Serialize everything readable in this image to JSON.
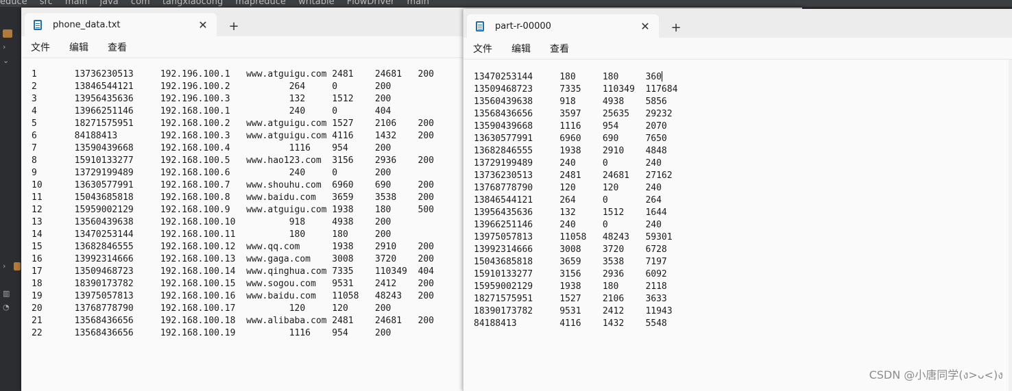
{
  "ide": {
    "breadcrumbs": [
      "educe",
      "src",
      "main",
      "java",
      "com",
      "tangxiaocong",
      "mapreduce",
      "writable",
      "FlowDriver",
      "main"
    ]
  },
  "left_window": {
    "tab_title": "phone_data.txt",
    "close_symbol": "✕",
    "new_tab_symbol": "+",
    "menu": {
      "file": "文件",
      "edit": "编辑",
      "view": "查看"
    },
    "content": "1\t13736230513\t192.196.100.1\twww.atguigu.com\t2481\t24681\t200\n2\t13846544121\t192.196.100.2\t\t264\t0\t200\n3 \t13956435636\t192.196.100.3\t\t132\t1512\t200\n4 \t13966251146\t192.168.100.1\t\t240\t0\t404\n5 \t18271575951\t192.168.100.2\twww.atguigu.com\t1527\t2106\t200\n6 \t84188413\t192.168.100.3\twww.atguigu.com\t4116\t1432\t200\n7 \t13590439668\t192.168.100.4\t\t1116\t954\t200\n8 \t15910133277\t192.168.100.5\twww.hao123.com\t3156\t2936\t200\n9 \t13729199489\t192.168.100.6\t\t240\t0\t200\n10 \t13630577991\t192.168.100.7\twww.shouhu.com\t6960\t690\t200\n11 \t15043685818\t192.168.100.8\twww.baidu.com\t3659\t3538\t200\n12 \t15959002129\t192.168.100.9\twww.atguigu.com\t1938\t180\t500\n13 \t13560439638\t192.168.100.10\t\t918\t4938\t200\n14 \t13470253144\t192.168.100.11\t\t180\t180\t200\n15 \t13682846555\t192.168.100.12\twww.qq.com\t1938\t2910\t200\n16 \t13992314666\t192.168.100.13\twww.gaga.com\t3008\t3720\t200\n17 \t13509468723\t192.168.100.14\twww.qinghua.com\t7335\t110349\t404\n18 \t18390173782\t192.168.100.15\twww.sogou.com\t9531\t2412\t200\n19 \t13975057813\t192.168.100.16\twww.baidu.com\t11058\t48243\t200\n20 \t13768778790\t192.168.100.17\t\t120\t120\t200\n21 \t13568436656\t192.168.100.18\twww.alibaba.com\t2481\t24681\t200\n22 \t13568436656\t192.168.100.19\t\t1116\t954\t200"
  },
  "right_window": {
    "tab_title": "part-r-00000",
    "close_symbol": "✕",
    "new_tab_symbol": "+",
    "menu": {
      "file": "文件",
      "edit": "编辑",
      "view": "查看"
    },
    "content": "13470253144\t180\t180\t360\n13509468723\t7335\t110349\t117684\n13560439638\t918\t4938\t5856\n13568436656\t3597\t25635\t29232\n13590439668\t1116\t954\t2070\n13630577991\t6960\t690\t7650\n13682846555\t1938\t2910\t4848\n13729199489\t240\t0\t240\n13736230513\t2481\t24681\t27162\n13768778790\t120\t120\t240\n13846544121\t264\t0\t264\n13956435636\t132\t1512\t1644\n13966251146\t240\t0\t240\n13975057813\t11058\t48243\t59301\n13992314666\t3008\t3720\t6728\n15043685818\t3659\t3538\t7197\n15910133277\t3156\t2936\t6092\n15959002129\t1938\t180\t2118\n18271575951\t1527\t2106\t3633\n18390173782\t9531\t2412\t11943\n84188413\t4116\t1432\t5548"
  },
  "watermark": "CSDN @小唐同学(ง>ᴗ<)ง"
}
